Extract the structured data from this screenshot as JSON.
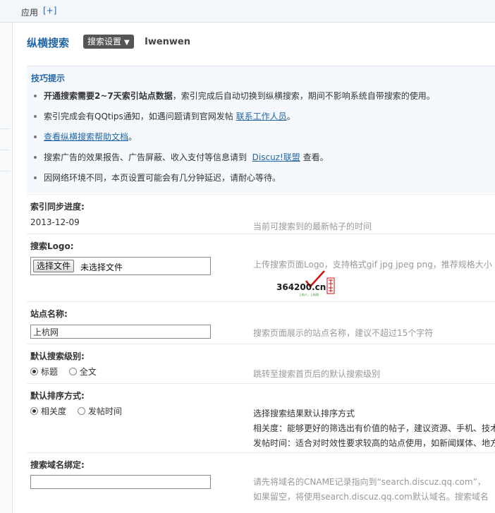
{
  "topbar": {
    "label": "应用",
    "add": "[+]"
  },
  "header": {
    "title": "纵横搜索",
    "menu_button": "搜索设置",
    "menu_arrow": "▼",
    "user": "Iwenwen"
  },
  "tips": {
    "title": "技巧提示",
    "items": [
      {
        "bold": "开通搜索需要2~7天索引站点数据",
        "text": "，索引完成后自动切换到纵横搜索，期间不影响系统自带搜索的使用。"
      },
      {
        "text": "索引完成会有QQtips通知，如遇问题请到官网发帖",
        "link": "联系工作人员",
        "after": "。"
      },
      {
        "link": "查看纵横搜索帮助文档",
        "after": "。"
      },
      {
        "text": "搜索广告的效果报告、广告屏蔽、收入支付等信息请到",
        "link": "Discuz!联盟",
        "after": "查看。"
      },
      {
        "text": "因网络环境不同，本页设置可能会有几分钟延迟，请耐心等待。"
      }
    ]
  },
  "sync": {
    "label": "索引同步进度:",
    "value": "2013-12-09",
    "desc": "当前可搜索到的最新帖子的时间"
  },
  "logo": {
    "label": "搜索Logo:",
    "file_button": "选择文件",
    "file_status": "未选择文件",
    "desc": "上传搜索页面Logo，支持格式gif jpg jpeg png，推荐规格大小",
    "preview_text": "364200.cn",
    "preview_sub": "上杭人，上杭网"
  },
  "sitename": {
    "label": "站点名称:",
    "value": "上杭网",
    "desc": "搜索页面展示的站点名称，建议不超过15个字符"
  },
  "level": {
    "label": "默认搜索级别:",
    "options": [
      "标题",
      "全文"
    ],
    "selected": 0,
    "desc": "跳转至搜索首页后的默认搜索级别"
  },
  "sort": {
    "label": "默认排序方式:",
    "options": [
      "相关度",
      "发帖时间"
    ],
    "selected": 0,
    "desc_title": "选择搜索结果默认排序方式",
    "desc_1": "相关度：能够更好的筛选出有价值的帖子，建议资源、手机、技术",
    "desc_2": "发帖时间：适合对时效性要求较高的站点使用，如新闻媒体、地方"
  },
  "domain": {
    "label": "搜索域名绑定:",
    "value": "",
    "desc_1": "请先将域名的CNAME记录指向到“search.discuz.qq.com”，",
    "desc_2": "如果留空，将使用search.discuz.qq.com默认域名。搜索域名"
  },
  "colors": {
    "accent": "#2366a8",
    "tips_bg": "#f5f9fd"
  }
}
